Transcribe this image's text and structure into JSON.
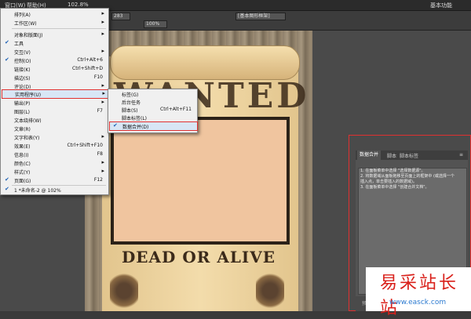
{
  "menubar": {
    "window_menu": "窗口(W)",
    "help_menu": "帮助(H)",
    "zoom": "102.8%",
    "workspace": "基本功能"
  },
  "toolbar": {
    "font_size": "283",
    "percent": "100%",
    "frame_label": "[基本图形框架]"
  },
  "window_menu": {
    "items": [
      {
        "label": "排列(A)",
        "shortcut": "",
        "submenu": true,
        "checked": false
      },
      {
        "label": "工作区(W)",
        "shortcut": "",
        "submenu": true,
        "checked": false
      },
      {
        "label": "对象和版面(J)",
        "shortcut": "",
        "submenu": true,
        "checked": false
      },
      {
        "label": "工具",
        "shortcut": "",
        "submenu": false,
        "checked": true
      },
      {
        "label": "交互(V)",
        "shortcut": "",
        "submenu": true,
        "checked": false
      },
      {
        "label": "控制(O)",
        "shortcut": "Ctrl+Alt+6",
        "submenu": false,
        "checked": true
      },
      {
        "label": "链接(K)",
        "shortcut": "Ctrl+Shift+D",
        "submenu": false,
        "checked": false
      },
      {
        "label": "描边(S)",
        "shortcut": "F10",
        "submenu": false,
        "checked": false
      },
      {
        "label": "评论(D)",
        "shortcut": "",
        "submenu": true,
        "checked": false
      },
      {
        "label": "实用程序(U)",
        "shortcut": "",
        "submenu": true,
        "checked": false
      },
      {
        "label": "输出(P)",
        "shortcut": "",
        "submenu": true,
        "checked": false
      },
      {
        "label": "图层(L)",
        "shortcut": "F7",
        "submenu": false,
        "checked": false
      },
      {
        "label": "文本绕排(W)",
        "shortcut": "",
        "submenu": false,
        "checked": false
      },
      {
        "label": "文章(R)",
        "shortcut": "",
        "submenu": false,
        "checked": false
      },
      {
        "label": "文字和表(Y)",
        "shortcut": "",
        "submenu": true,
        "checked": false
      },
      {
        "label": "效果(E)",
        "shortcut": "Ctrl+Shift+F10",
        "submenu": false,
        "checked": false
      },
      {
        "label": "信息(I)",
        "shortcut": "F8",
        "submenu": false,
        "checked": false
      },
      {
        "label": "颜色(C)",
        "shortcut": "",
        "submenu": true,
        "checked": false
      },
      {
        "label": "样式(Y)",
        "shortcut": "",
        "submenu": true,
        "checked": false
      },
      {
        "label": "页面(G)",
        "shortcut": "F12",
        "submenu": false,
        "checked": true
      },
      {
        "label": "1 *未命名-2 @ 102%",
        "shortcut": "",
        "submenu": false,
        "checked": true
      }
    ]
  },
  "utility_submenu": {
    "items": [
      {
        "label": "标签(G)",
        "shortcut": ""
      },
      {
        "label": "后台任务",
        "shortcut": ""
      },
      {
        "label": "脚本(S)",
        "shortcut": "Ctrl+Alt+F11"
      },
      {
        "label": "脚本标签(L)",
        "shortcut": ""
      },
      {
        "label": "数据合并(D)",
        "shortcut": "",
        "checked": true
      }
    ]
  },
  "document": {
    "headline": "WANTED",
    "subline": "DEAD OR ALIVE"
  },
  "panel": {
    "tabs": [
      "数据合并",
      "脚本",
      "脚本标签"
    ],
    "instructions": [
      "1. 在面板菜单中选择 \"选择数据源\"。",
      "2. 将数据域从面板拖移至页面上的框架中 (或选择一个",
      "插入点，单击要插入的数据域)。",
      "3. 在面板菜单中选择 \"创建合并文档\"。"
    ],
    "footer_label": "预览"
  },
  "watermark": {
    "title": "易采站长站",
    "url": "www.easck.com"
  }
}
